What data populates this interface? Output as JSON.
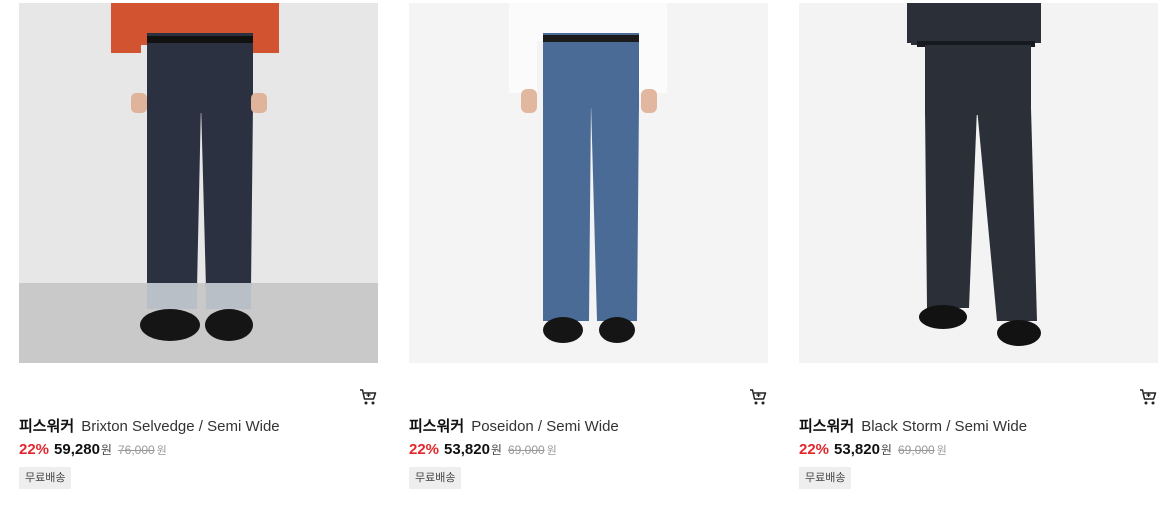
{
  "products": [
    {
      "brand": "피스워커",
      "name": "Brixton Selvedge / Semi Wide",
      "discount": "22%",
      "price": "59,280",
      "currency": "원",
      "original_price": "76,000",
      "badge": "무료배송",
      "image_colors": {
        "background": "#e7e7e7",
        "floor": "#c9c9c9",
        "shirt": "#d2532f",
        "denim": "#2b3140",
        "cuff": "#b9bfc6",
        "shoes": "#151515"
      }
    },
    {
      "brand": "피스워커",
      "name": "Poseidon / Semi Wide",
      "discount": "22%",
      "price": "53,820",
      "currency": "원",
      "original_price": "69,000",
      "badge": "무료배송",
      "image_colors": {
        "background": "#f4f4f4",
        "floor": "#f4f4f4",
        "shirt": "#fbfbfb",
        "denim": "#4a6b95",
        "cuff": "#4a6b95",
        "shoes": "#151515"
      }
    },
    {
      "brand": "피스워커",
      "name": "Black Storm / Semi Wide",
      "discount": "22%",
      "price": "53,820",
      "currency": "원",
      "original_price": "69,000",
      "badge": "무료배송",
      "image_colors": {
        "background": "#f3f3f3",
        "floor": "#f3f3f3",
        "shirt": "#2a2f38",
        "denim": "#2a2f38",
        "cuff": "#2a2f38",
        "shoes": "#121212"
      }
    }
  ],
  "icons": {
    "cart": "cart-icon"
  },
  "colors": {
    "discount": "#e3262c",
    "badge_bg": "#eeeeee"
  }
}
